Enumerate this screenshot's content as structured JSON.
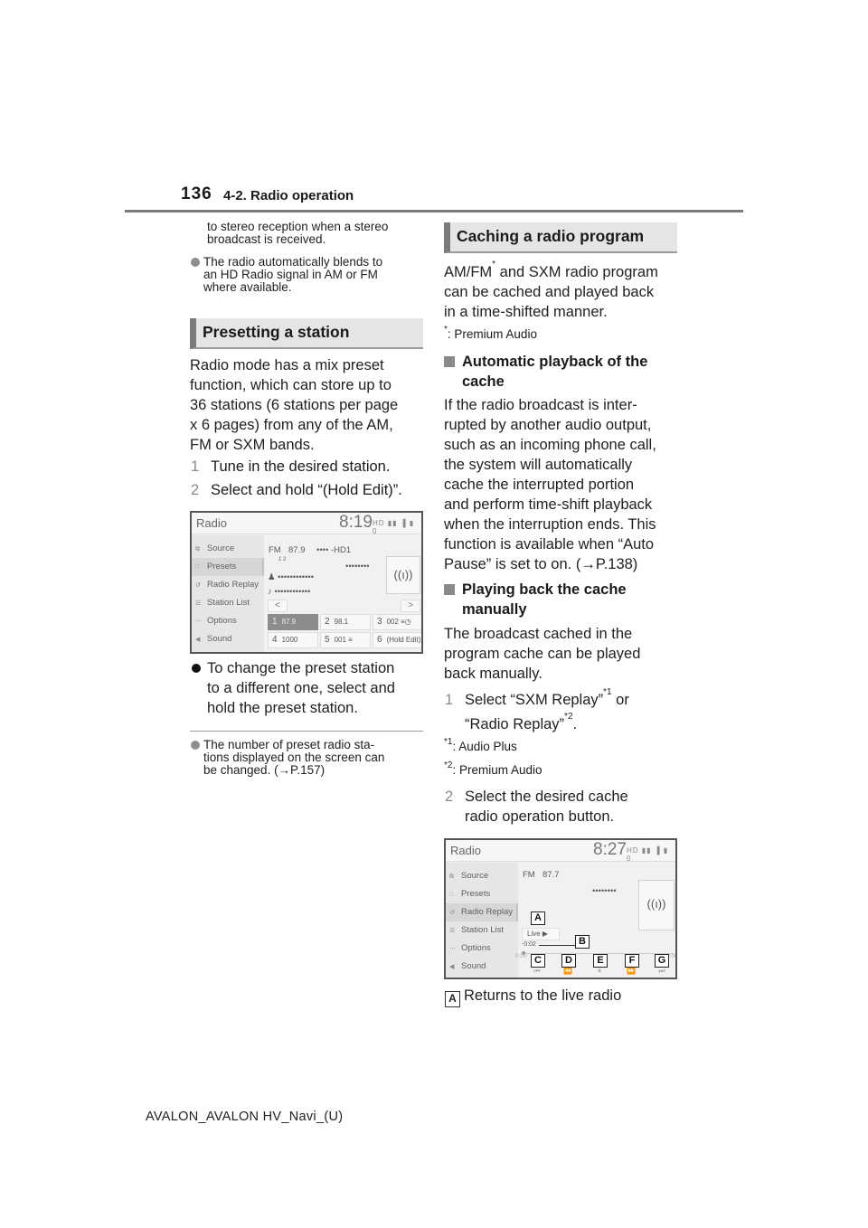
{
  "header": {
    "page_number": "136",
    "section": "4-2. Radio operation"
  },
  "left_column": {
    "intro_continuation": [
      "to stereo reception when a stereo",
      "broadcast is received."
    ],
    "note_hd": [
      "The radio automatically blends to",
      "an HD Radio signal in AM or FM",
      "where available."
    ],
    "presetting": {
      "heading": "Presetting a station",
      "body": [
        "Radio mode has a mix preset",
        "function, which can store up to",
        "36 stations (6 stations per page",
        "x 6 pages) from any of the AM,",
        "FM or SXM bands."
      ],
      "steps": [
        {
          "num": "1",
          "text": "Tune in the desired station."
        },
        {
          "num": "2",
          "text": "Select and hold “(Hold Edit)”."
        }
      ],
      "bullet": [
        "To change the preset station",
        "to a different one, select and",
        "hold the preset station."
      ],
      "note": [
        "The number of preset radio sta-",
        "tions displayed on the screen can",
        "be changed. (→P.157)"
      ]
    }
  },
  "screen1": {
    "title": "Radio",
    "clock": "8:19",
    "status_icons": "HD ▮▮ ▐ ▮ 0",
    "menu": [
      {
        "icon": "source-icon",
        "glyph": "⧉",
        "label": "Source",
        "selected": false
      },
      {
        "icon": "presets-icon",
        "glyph": "∷",
        "label": "Presets",
        "selected": true
      },
      {
        "icon": "replay-icon",
        "glyph": "↺",
        "label": "Radio Replay",
        "selected": false
      },
      {
        "icon": "station-list-icon",
        "glyph": "☰",
        "label": "Station List",
        "selected": false
      },
      {
        "icon": "options-icon",
        "glyph": "⋯",
        "label": "Options",
        "selected": false
      },
      {
        "icon": "sound-icon",
        "glyph": "◀",
        "label": "Sound",
        "selected": false
      }
    ],
    "band": "FM",
    "frequency": "87.9",
    "station_name": "•••• -HD1",
    "hd_channels": "1 2",
    "program_name": "••••••••",
    "artist": "••••••••••••",
    "song": "••••••••••••",
    "antenna_glyph": "((ı))",
    "prev_label": "<",
    "next_label": ">",
    "presets": [
      {
        "num": "1",
        "value": "87.9",
        "active": true
      },
      {
        "num": "2",
        "value": "98.1",
        "active": false
      },
      {
        "num": "3",
        "value": "002 ≡◷",
        "active": false
      },
      {
        "num": "4",
        "value": "1000",
        "active": false
      },
      {
        "num": "5",
        "value": "001 ≡",
        "active": false
      },
      {
        "num": "6",
        "value": "(Hold Edit)",
        "active": false
      }
    ]
  },
  "right_column": {
    "caching": {
      "heading": "Caching a radio program",
      "body_1": "AM/FM",
      "body_1_sup": "*",
      "body_1_rest": " and SXM radio program",
      "body_lines": [
        "can be cached and played back",
        "in a time-shifted manner."
      ],
      "footnote_mark": "*",
      "footnote": ": Premium Audio"
    },
    "auto_playback": {
      "heading": [
        "Automatic playback of the",
        "cache"
      ],
      "body": [
        "If the radio broadcast is inter-",
        "rupted by another audio output,",
        "such as an incoming phone call,",
        "the system will automatically",
        "cache the interrupted portion",
        "and perform time-shift playback",
        "when the interruption ends. This",
        "function is available when “Auto",
        "Pause” is set to on. (→P.138)"
      ]
    },
    "manual_playback": {
      "heading": [
        "Playing back the cache",
        "manually"
      ],
      "body": [
        "The broadcast cached in the",
        "program cache can be played",
        "back manually."
      ],
      "step1": {
        "num": "1",
        "line1": "Select “SXM Replay”",
        "sup1": "*1",
        "line1_end": " or",
        "line2": "“Radio Replay”",
        "sup2": "*2",
        "line2_end": "."
      },
      "footnotes": [
        {
          "mark": "*1",
          "text": ": Audio Plus"
        },
        {
          "mark": "*2",
          "text": ": Premium Audio"
        }
      ],
      "step2": {
        "num": "2",
        "lines": [
          "Select the desired cache",
          "radio operation button."
        ]
      }
    },
    "legend": [
      {
        "key": "A",
        "text": "Returns to the live radio"
      }
    ]
  },
  "screen2": {
    "title": "Radio",
    "clock": "8:27",
    "status_icons": "HD ▮▮ ▐ ▮ 0",
    "menu": [
      {
        "icon": "source-icon",
        "glyph": "⧉",
        "label": "Source",
        "selected": false
      },
      {
        "icon": "presets-icon",
        "glyph": "∷",
        "label": "Presets",
        "selected": false
      },
      {
        "icon": "replay-icon",
        "glyph": "↺",
        "label": "Radio Replay",
        "selected": true
      },
      {
        "icon": "station-list-icon",
        "glyph": "☰",
        "label": "Station List",
        "selected": false
      },
      {
        "icon": "options-icon",
        "glyph": "⋯",
        "label": "Options",
        "selected": false
      },
      {
        "icon": "sound-icon",
        "glyph": "◀",
        "label": "Sound",
        "selected": false
      }
    ],
    "band": "FM",
    "frequency": "87.7",
    "program_name": "••••••••",
    "antenna_glyph": "((ı))",
    "live_label": "Live ▶",
    "time_offset": "-0:02",
    "progress_start": "0:00",
    "progress_end": "0:00",
    "controls": [
      {
        "name": "skip-back",
        "glyph": "⏮",
        "callout": "C"
      },
      {
        "name": "rewind",
        "glyph": "⏪",
        "callout": "D"
      },
      {
        "name": "pause",
        "glyph": "⏸",
        "callout": "E"
      },
      {
        "name": "fast-forward",
        "glyph": "⏩",
        "callout": "F"
      },
      {
        "name": "skip-forward",
        "glyph": "⏭",
        "callout": "G"
      }
    ],
    "callout_a": "A",
    "callout_b": "B"
  },
  "footer": {
    "model": "AVALON_AVALON HV_Navi_(U)"
  }
}
